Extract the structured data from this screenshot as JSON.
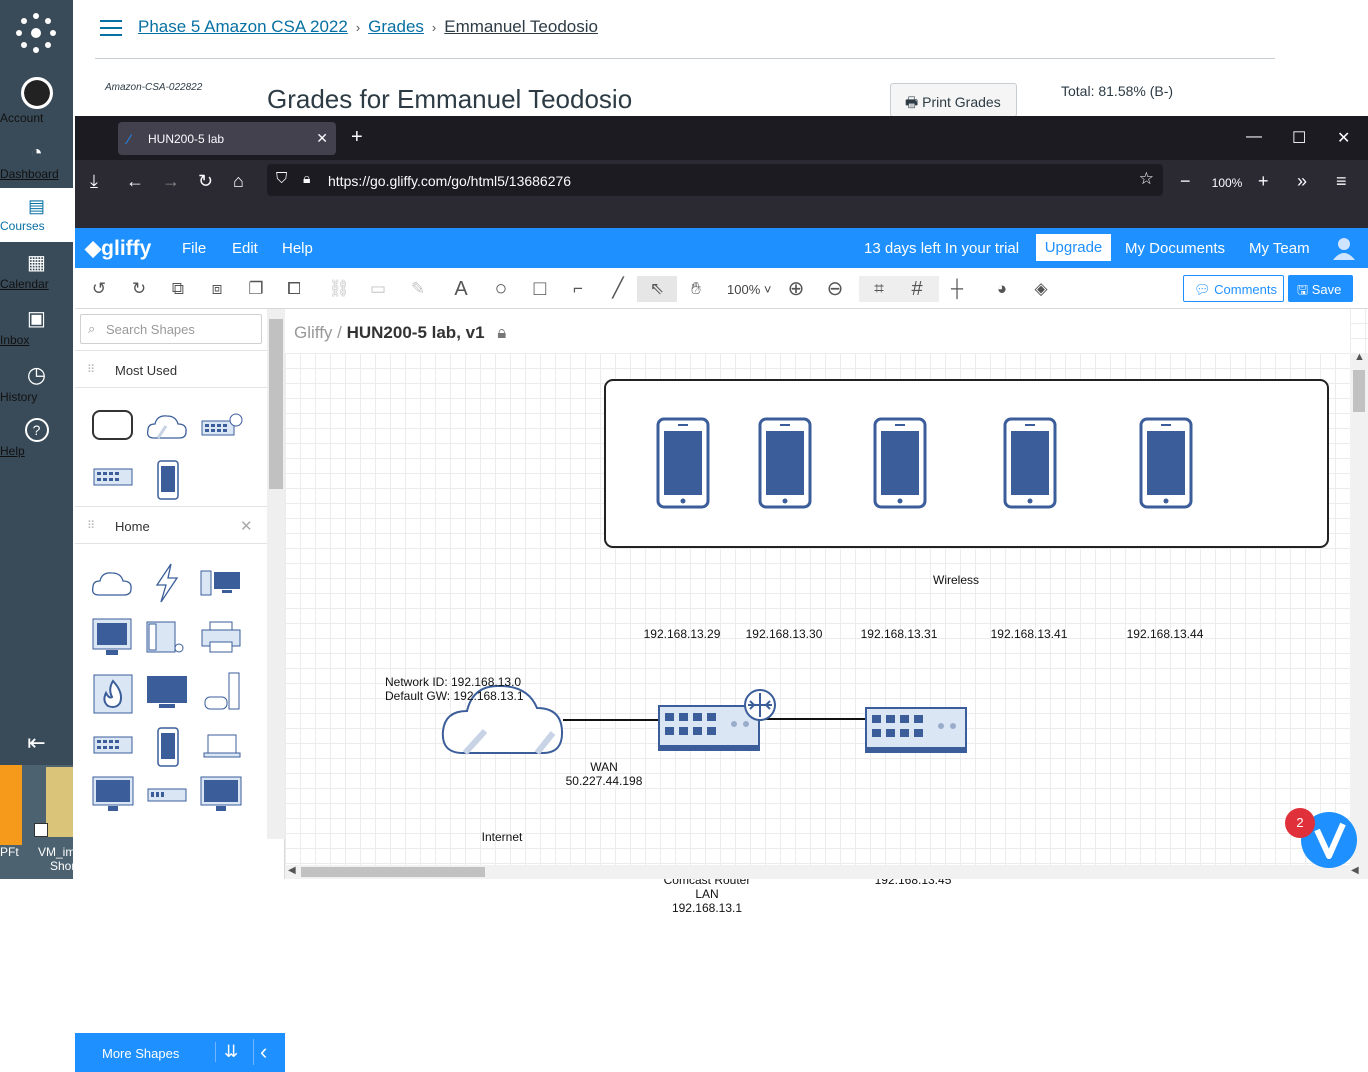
{
  "canvas_nav": {
    "items": [
      {
        "label": "Account"
      },
      {
        "label": "Dashboard"
      },
      {
        "label": "Courses"
      },
      {
        "label": "Calendar"
      },
      {
        "label": "Inbox"
      },
      {
        "label": "History"
      },
      {
        "label": "Help"
      }
    ],
    "desktop_labels": [
      "PFt",
      "VM_im",
      "Shor"
    ]
  },
  "canvas_page": {
    "breadcrumb": [
      "Phase 5 Amazon CSA 2022",
      "Grades",
      "Emmanuel Teodosio"
    ],
    "course_code": "Amazon-CSA-022822",
    "title": "Grades for Emmanuel Teodosio",
    "print_button": "Print Grades",
    "total": "Total: 81.58% (B-)"
  },
  "browser": {
    "tab_title": "HUN200-5 lab",
    "url": "https://go.gliffy.com/go/html5/13686276",
    "zoom": "100%"
  },
  "gliffy": {
    "brand": "gliffy",
    "menu": [
      "File",
      "Edit",
      "Help"
    ],
    "trial_text": "13 days left In your trial",
    "upgrade": "Upgrade",
    "my_documents": "My Documents",
    "my_team": "My Team",
    "zoom": "100%",
    "comments": "Comments",
    "save": "Save",
    "search_placeholder": "Search Shapes",
    "section_most_used": "Most Used",
    "section_home": "Home",
    "more_shapes": "More Shapes",
    "breadcrumb_root": "Gliffy",
    "doc_title": "HUN200-5 lab, v1",
    "notification_count": "2"
  },
  "diagram": {
    "wireless_label": "Wireless",
    "phones": [
      "192.168.13.29",
      "192.168.13.30",
      "192.168.13.31",
      "192.168.13.41",
      "192.168.13.44"
    ],
    "network_id": "Network ID: 192.168.13.0",
    "default_gw": "Default GW: 192.168.13.1",
    "wan_label": "WAN",
    "wan_ip": "50.227.44.198",
    "internet": "Internet",
    "router_name": "Comcast Router",
    "router_lan": "LAN",
    "router_ip": "192.168.13.1",
    "switch_ip": "192.168.13.45"
  },
  "colors": {
    "canvas_nav": "#394b58",
    "gliffy_blue": "#1e90ff",
    "device_blue": "#3b5e9a",
    "link": "#0770a3"
  }
}
